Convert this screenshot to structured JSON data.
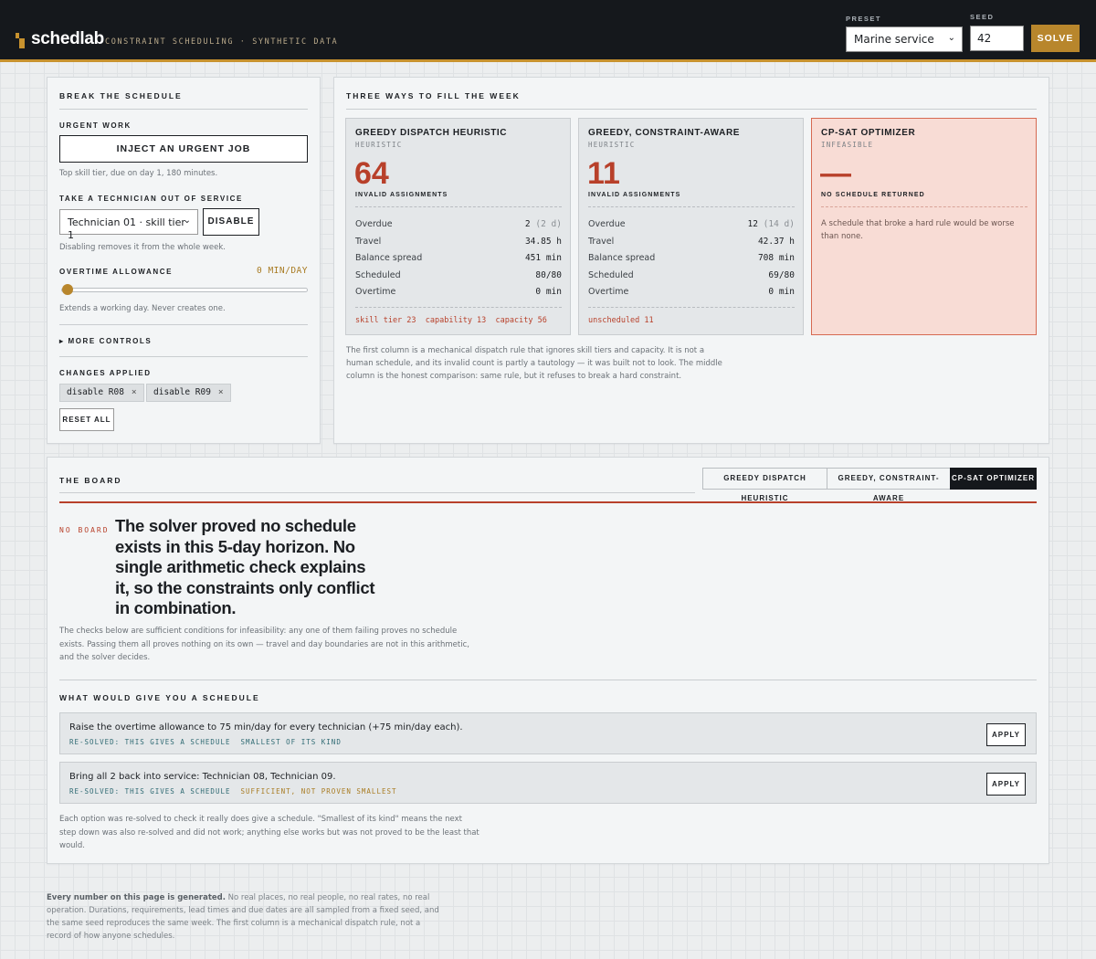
{
  "header": {
    "brand": "schedlab",
    "tagline": "CONSTRAINT SCHEDULING · SYNTHETIC DATA",
    "preset_label": "PRESET",
    "preset_value": "Marine service",
    "seed_label": "SEED",
    "seed_value": "42",
    "solve_label": "SOLVE",
    "accent": "#c8922e"
  },
  "left": {
    "title": "BREAK THE SCHEDULE",
    "urgent_label": "URGENT WORK",
    "inject_label": "INJECT AN URGENT JOB",
    "inject_help": "Top skill tier, due on day 1, 180 minutes.",
    "tech_label": "TAKE A TECHNICIAN OUT OF SERVICE",
    "tech_value": "Technician 01 · skill tier 1",
    "disable_label": "DISABLE",
    "tech_help": "Disabling removes it from the whole week.",
    "overtime_label": "OVERTIME ALLOWANCE",
    "overtime_value": "0 MIN/DAY",
    "overtime_fraction": 0,
    "overtime_help": "Extends a working day. Never creates one.",
    "more_label": "▸ MORE CONTROLS",
    "changes_label": "CHANGES APPLIED",
    "chips": [
      "disable R08",
      "disable R09"
    ],
    "reset_label": "RESET ALL"
  },
  "methods": {
    "title": "THREE WAYS TO FILL THE WEEK",
    "cards": [
      {
        "name": "GREEDY DISPATCH HEURISTIC",
        "kind": "HEURISTIC",
        "big": "64",
        "big_label": "INVALID ASSIGNMENTS",
        "rows": [
          {
            "k": "Overdue",
            "v": "2",
            "d": "(2 d)"
          },
          {
            "k": "Travel",
            "v": "34.85 h",
            "d": ""
          },
          {
            "k": "Balance spread",
            "v": "451 min",
            "d": ""
          },
          {
            "k": "Scheduled",
            "v": "80/80",
            "d": ""
          },
          {
            "k": "Overtime",
            "v": "0 min",
            "d": ""
          }
        ],
        "violations": "skill tier 23  capability 13  capacity 56"
      },
      {
        "name": "GREEDY, CONSTRAINT-AWARE",
        "kind": "HEURISTIC",
        "big": "11",
        "big_label": "INVALID ASSIGNMENTS",
        "rows": [
          {
            "k": "Overdue",
            "v": "12",
            "d": "(14 d)"
          },
          {
            "k": "Travel",
            "v": "42.37 h",
            "d": ""
          },
          {
            "k": "Balance spread",
            "v": "708 min",
            "d": ""
          },
          {
            "k": "Scheduled",
            "v": "69/80",
            "d": ""
          },
          {
            "k": "Overtime",
            "v": "0 min",
            "d": ""
          }
        ],
        "violations": "unscheduled 11"
      },
      {
        "name": "CP-SAT OPTIMIZER",
        "kind": "INFEASIBLE",
        "big": "—",
        "big_label": "NO SCHEDULE RETURNED",
        "note": "A schedule that broke a hard rule would be worse than none."
      }
    ],
    "caption": "The first column is a mechanical dispatch rule that ignores skill tiers and capacity. It is not a human schedule, and its invalid count is partly a tautology — it was built not to look. The middle column is the honest comparison: same rule, but it refuses to break a hard constraint."
  },
  "board": {
    "title": "THE BOARD",
    "tabs": [
      "GREEDY DISPATCH HEURISTIC",
      "GREEDY, CONSTRAINT-AWARE",
      "CP-SAT OPTIMIZER"
    ],
    "active_tab": 2,
    "tag": "NO BOARD",
    "headline": "The solver proved no schedule exists in this 5-day horizon. No single arithmetic check explains it, so the constraints only conflict in combination.",
    "explain": "The checks below are sufficient conditions for infeasibility: any one of them failing proves no schedule exists. Passing them all proves nothing on its own — travel and day boundaries are not in this arithmetic, and the solver decides.",
    "fixes_title": "WHAT WOULD GIVE YOU A SCHEDULE",
    "fixes": [
      {
        "text": "Raise the overtime allowance to 75 min/day for every technician (+75 min/day each).",
        "status_a": "RE-SOLVED: THIS GIVES A SCHEDULE",
        "status_b": "SMALLEST OF ITS KIND",
        "apply": "APPLY"
      },
      {
        "text": "Bring all 2 back into service: Technician 08, Technician 09.",
        "status_a": "RE-SOLVED: THIS GIVES A SCHEDULE",
        "status_b": "SUFFICIENT, NOT PROVEN SMALLEST",
        "apply": "APPLY"
      }
    ],
    "fixes_note": "Each option was re-solved to check it really does give a schedule. \"Smallest of its kind\" means the next step down was also re-solved and did not work; anything else works but was not proved to be the least that would."
  },
  "footer": {
    "bold": "Every number on this page is generated.",
    "text": " No real places, no real people, no real rates, no real operation. Durations, requirements, lead times and due dates are all sampled from a fixed seed, and the same seed reproduces the same week. The first column is a mechanical dispatch rule, not a record of how anyone schedules."
  }
}
